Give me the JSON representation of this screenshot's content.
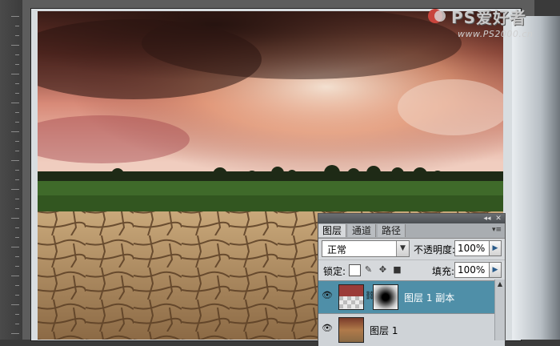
{
  "watermark": {
    "title": "PS爱好者",
    "url": "www.PS2000.cn"
  },
  "layers_panel": {
    "tabs": [
      {
        "label": "图层",
        "active": true
      },
      {
        "label": "通道",
        "active": false
      },
      {
        "label": "路径",
        "active": false
      }
    ],
    "blend_mode": "正常",
    "opacity_label": "不透明度:",
    "opacity_value": "100%",
    "lock_label": "锁定:",
    "fill_label": "填充:",
    "fill_value": "100%",
    "layers": [
      {
        "name": "图层 1 副本",
        "selected": true,
        "visible": true,
        "has_mask": true
      },
      {
        "name": "图层 1",
        "selected": false,
        "visible": true,
        "has_mask": false
      }
    ]
  },
  "colors": {
    "selected_layer": "#4f8fa8",
    "panel_bg": "#d6d9dc"
  }
}
